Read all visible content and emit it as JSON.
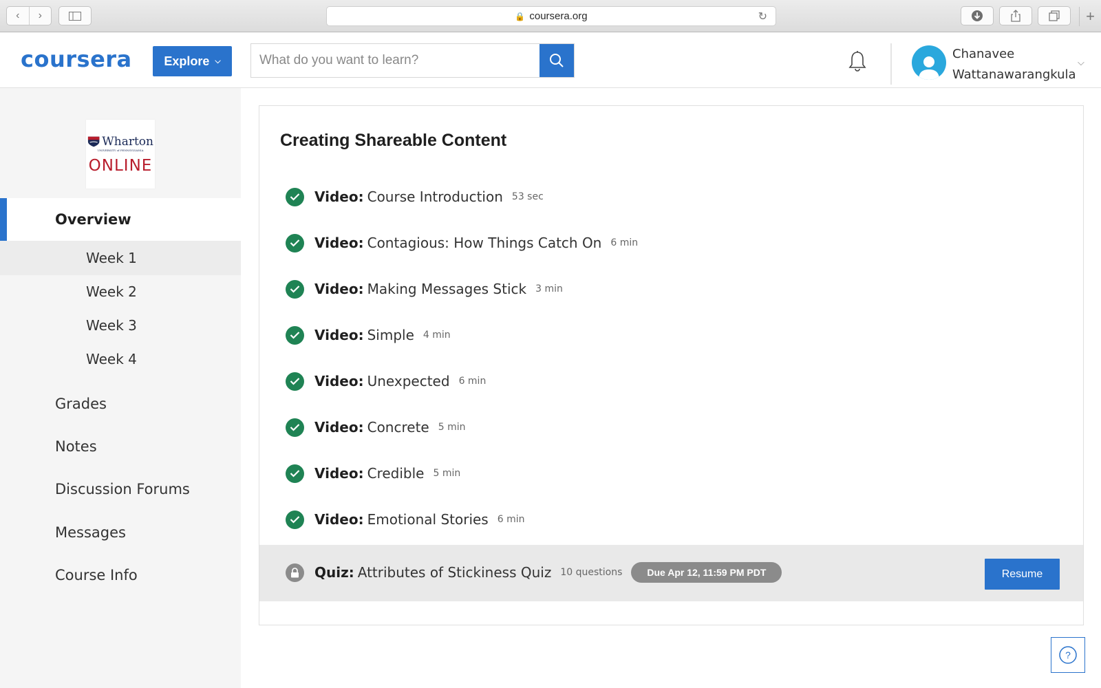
{
  "browser": {
    "url": "coursera.org"
  },
  "header": {
    "logo": "coursera",
    "explore_label": "Explore",
    "search_placeholder": "What do you want to learn?",
    "user_first": "Chanavee",
    "user_last": "Wattanawarangkula"
  },
  "sidebar": {
    "partner_logo": {
      "name": "Wharton",
      "subtitle": "UNIVERSITY of PENNSYLVANIA",
      "online": "ONLINE"
    },
    "overview": "Overview",
    "weeks": [
      "Week 1",
      "Week 2",
      "Week 3",
      "Week 4"
    ],
    "selected_week": "Week 1",
    "links": [
      "Grades",
      "Notes",
      "Discussion Forums",
      "Messages",
      "Course Info"
    ]
  },
  "main": {
    "title": "Creating Shareable Content",
    "items": [
      {
        "kind": "Video:",
        "title": "Course Introduction",
        "duration": "53 sec",
        "completed": true
      },
      {
        "kind": "Video:",
        "title": "Contagious: How Things Catch On",
        "duration": "6 min",
        "completed": true
      },
      {
        "kind": "Video:",
        "title": "Making Messages Stick",
        "duration": "3 min",
        "completed": true
      },
      {
        "kind": "Video:",
        "title": "Simple",
        "duration": "4 min",
        "completed": true
      },
      {
        "kind": "Video:",
        "title": "Unexpected",
        "duration": "6 min",
        "completed": true
      },
      {
        "kind": "Video:",
        "title": "Concrete",
        "duration": "5 min",
        "completed": true
      },
      {
        "kind": "Video:",
        "title": "Credible",
        "duration": "5 min",
        "completed": true
      },
      {
        "kind": "Video:",
        "title": "Emotional Stories",
        "duration": "6 min",
        "completed": true
      }
    ],
    "quiz": {
      "kind": "Quiz:",
      "title": "Attributes of Stickiness Quiz",
      "questions": "10 questions",
      "due": "Due Apr 12, 11:59 PM PDT",
      "action": "Resume"
    }
  },
  "help": {
    "label": "?"
  },
  "colors": {
    "brand": "#2a73cc",
    "complete": "#1f8354",
    "locked": "#8b8b8b"
  }
}
